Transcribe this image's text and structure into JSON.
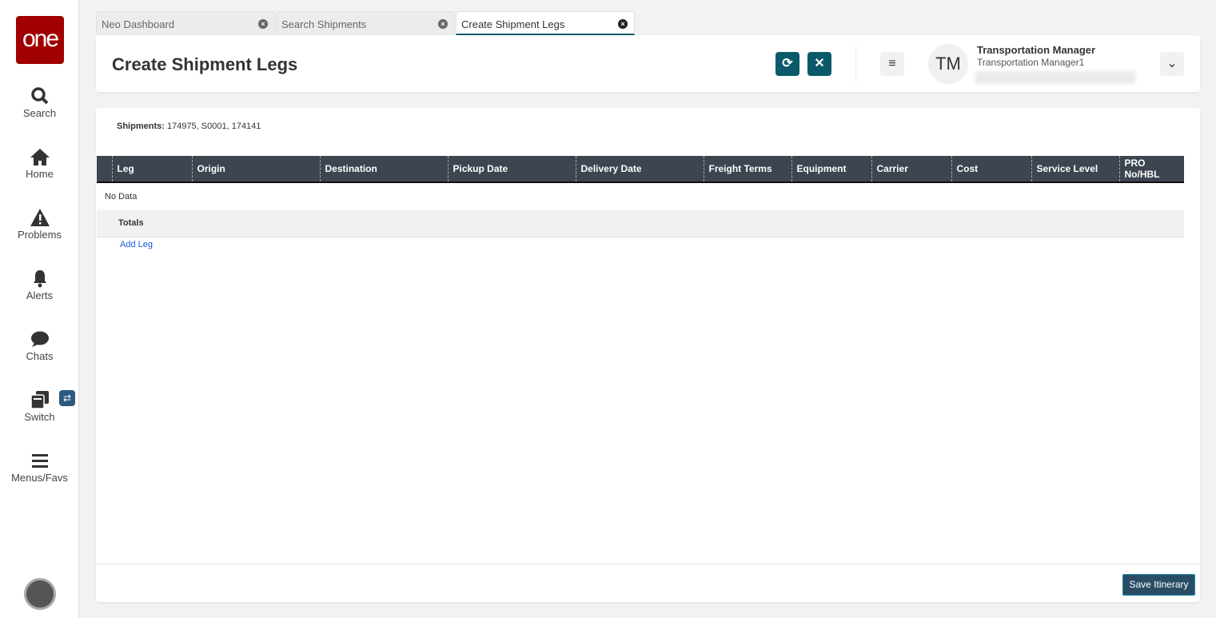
{
  "sidebar": {
    "logo": "one",
    "items": [
      {
        "label": "Search"
      },
      {
        "label": "Home"
      },
      {
        "label": "Problems"
      },
      {
        "label": "Alerts"
      },
      {
        "label": "Chats"
      },
      {
        "label": "Switch"
      },
      {
        "label": "Menus/Favs"
      }
    ]
  },
  "tabs": [
    {
      "label": "Neo Dashboard"
    },
    {
      "label": "Search Shipments"
    },
    {
      "label": "Create Shipment Legs"
    }
  ],
  "header": {
    "title": "Create Shipment Legs",
    "user_initials": "TM",
    "user_name": "Transportation Manager",
    "user_role": "Transportation Manager1"
  },
  "main": {
    "shipments_label": "Shipments:",
    "shipments_value": "174975, S0001, 174141",
    "columns": [
      "",
      "Leg",
      "Origin",
      "Destination",
      "Pickup Date",
      "Delivery Date",
      "Freight Terms",
      "Equipment",
      "Carrier",
      "Cost",
      "Service Level",
      "PRO No/HBL"
    ],
    "no_data": "No Data",
    "totals": "Totals",
    "add_leg": "Add Leg",
    "save": "Save Itinerary"
  },
  "colors": {
    "accent": "#0b5a6b",
    "logo": "#a00000",
    "header_row": "#3c4550"
  }
}
